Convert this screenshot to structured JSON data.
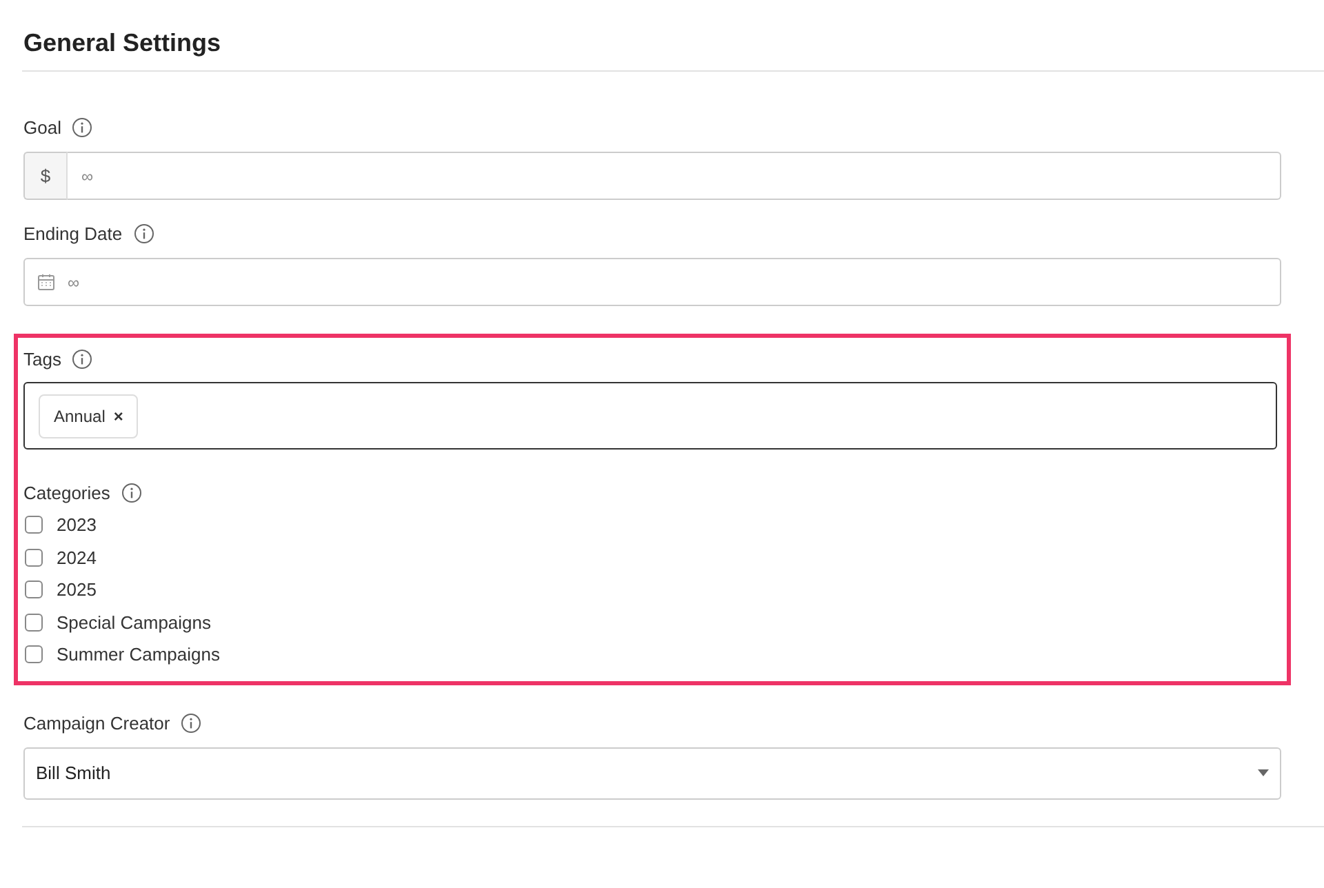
{
  "title": "General Settings",
  "goal": {
    "label": "Goal",
    "prefix": "$",
    "placeholder": "∞"
  },
  "ending_date": {
    "label": "Ending Date",
    "placeholder": "∞"
  },
  "tags": {
    "label": "Tags",
    "items": [
      "Annual"
    ],
    "remove": "×"
  },
  "categories": {
    "label": "Categories",
    "items": [
      {
        "label": "2023",
        "checked": false
      },
      {
        "label": "2024",
        "checked": false
      },
      {
        "label": "2025",
        "checked": false
      },
      {
        "label": "Special Campaigns",
        "checked": false
      },
      {
        "label": "Summer Campaigns",
        "checked": false
      }
    ]
  },
  "campaign_creator": {
    "label": "Campaign Creator",
    "value": "Bill Smith"
  }
}
